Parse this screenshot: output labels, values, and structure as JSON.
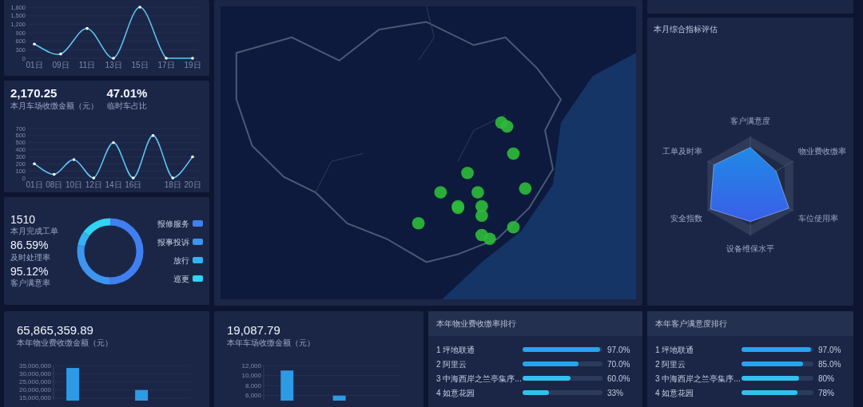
{
  "left_column": {
    "daily_chart": {
      "chart_data": {
        "type": "line",
        "grid": true,
        "ylim": [
          0,
          1800
        ],
        "categories": [
          "01日",
          "09日",
          "11日",
          "13日",
          "15日",
          "17日",
          "19日"
        ],
        "values": [
          500,
          150,
          1050,
          0,
          1800,
          0,
          0
        ],
        "yticks": [
          {
            "value": 0,
            "label": "0"
          },
          {
            "value": 300,
            "label": "300"
          },
          {
            "value": 600,
            "label": "600"
          },
          {
            "value": 900,
            "label": "900"
          },
          {
            "value": 1200,
            "label": "1,200"
          },
          {
            "value": 1500,
            "label": "1,500"
          },
          {
            "value": 1800,
            "label": "1,800"
          }
        ]
      }
    },
    "parking_summary": {
      "stats": [
        {
          "value": "2,170.25",
          "label": "本月车场收缴金额（元）"
        },
        {
          "value": "47.01%",
          "label": "临时车占比"
        }
      ],
      "chart_data": {
        "type": "line",
        "grid": true,
        "ylim": [
          0,
          700
        ],
        "categories": [
          "01日",
          "08日",
          "10日",
          "12日",
          "14日",
          "16日",
          null,
          "18日",
          "20日"
        ],
        "values": [
          200,
          50,
          260,
          0,
          500,
          0,
          600,
          0,
          300
        ],
        "yticks": [
          0,
          100,
          200,
          300,
          400,
          500,
          600,
          700
        ]
      }
    },
    "work_orders": {
      "stats": [
        {
          "value": "1510",
          "label": "本月完成工单"
        },
        {
          "value": "86.59%",
          "label": "及时处理率"
        },
        {
          "value": "95.12%",
          "label": "客户满意率"
        }
      ],
      "legend": [
        {
          "label": "报修服务",
          "color": "#3f7ff0"
        },
        {
          "label": "报事投诉",
          "color": "#3d95f0"
        },
        {
          "label": "放行",
          "color": "#35b2f0"
        },
        {
          "label": "巡更",
          "color": "#2fd3f4"
        }
      ]
    }
  },
  "radar_panel": {
    "title": "本月综合指标评估",
    "axes": [
      "客户满意度",
      "物业费收缴率",
      "车位使用率",
      "设备维保水平",
      "安全指数",
      "工单及时率"
    ]
  },
  "bottom_row": {
    "property_fee": {
      "value": "65,865,359.89",
      "label": "本年物业费收缴金额（元）",
      "chart_data": {
        "type": "bar",
        "grid": true,
        "ylim": [
          13500000,
          35000000
        ],
        "values": [
          33500000,
          20000000
        ],
        "yticks": [
          {
            "value": 15000000,
            "label": "15,000,000"
          },
          {
            "value": 20000000,
            "label": "20,000,000"
          },
          {
            "value": 25000000,
            "label": "25,000,000"
          },
          {
            "value": 30000000,
            "label": "30,000,000"
          },
          {
            "value": 35000000,
            "label": "35,000,000"
          }
        ]
      }
    },
    "parking_fee": {
      "value": "19,087.79",
      "label": "本年车场收缴金额（元）",
      "chart_data": {
        "type": "bar",
        "grid": true,
        "ylim": [
          5000,
          12000
        ],
        "values": [
          11000,
          6000
        ],
        "yticks": [
          {
            "value": 6000,
            "label": "6,000"
          },
          {
            "value": 8000,
            "label": "8,000"
          },
          {
            "value": 10000,
            "label": "10,000"
          },
          {
            "value": 12000,
            "label": "12,000"
          }
        ]
      }
    },
    "rankings": [
      {
        "title": "本年物业费收缴率排行",
        "rows": [
          {
            "rank": "1",
            "name": "坪地联通",
            "level": 0.97,
            "reading": "97.0%"
          },
          {
            "rank": "2",
            "name": "阿里云",
            "level": 0.7,
            "reading": "70.0%"
          },
          {
            "rank": "3",
            "name": "中海西岸之兰亭集序...",
            "level": 0.6,
            "reading": "60.0%"
          },
          {
            "rank": "4",
            "name": "如意花园",
            "level": 0.33,
            "reading": "33%"
          }
        ]
      },
      {
        "title": "本年客户满意度排行",
        "rows": [
          {
            "rank": "1",
            "name": "坪地联通",
            "level": 0.97,
            "reading": "97.0%"
          },
          {
            "rank": "2",
            "name": "阿里云",
            "level": 0.85,
            "reading": "85.0%"
          },
          {
            "rank": "3",
            "name": "中海西岸之兰亭集序...",
            "level": 0.8,
            "reading": "80%"
          },
          {
            "rank": "4",
            "name": "如意花园",
            "level": 0.78,
            "reading": "78%"
          }
        ]
      }
    ]
  }
}
